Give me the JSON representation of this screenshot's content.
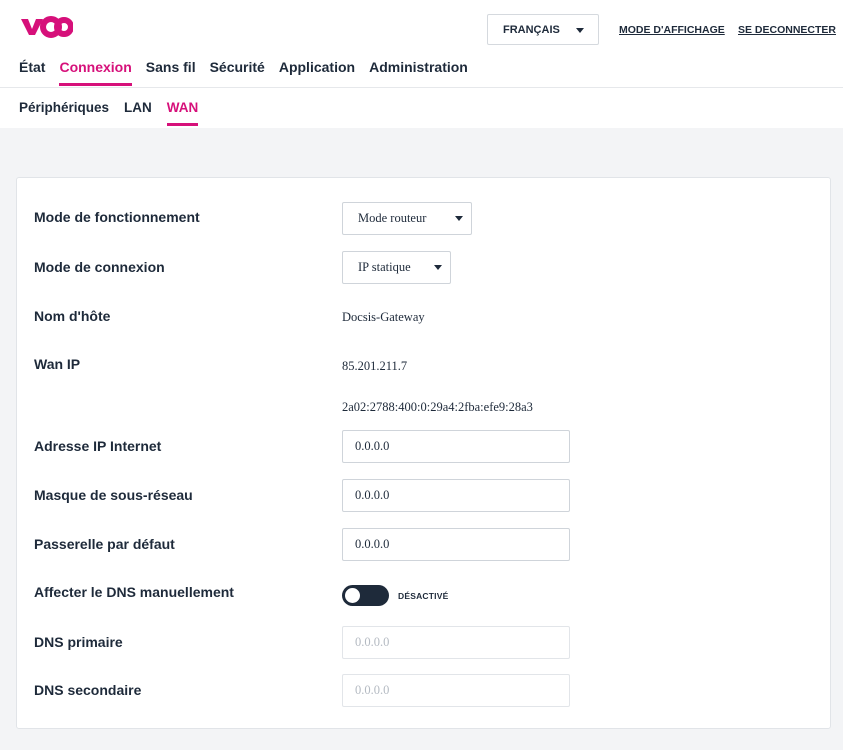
{
  "brand": {
    "logo_text": "voo",
    "accent": "#d6107a"
  },
  "header": {
    "language": "FRANÇAIS",
    "display_mode": "MODE D'AFFICHAGE",
    "logout": "SE DECONNECTER"
  },
  "main_nav": [
    "État",
    "Connexion",
    "Sans fil",
    "Sécurité",
    "Application",
    "Administration"
  ],
  "main_nav_active": "Connexion",
  "sub_nav": [
    "Périphériques",
    "LAN",
    "WAN"
  ],
  "sub_nav_active": "WAN",
  "form": {
    "operating_mode": {
      "label": "Mode de fonctionnement",
      "value": "Mode routeur"
    },
    "connection_mode": {
      "label": "Mode de connexion",
      "value": "IP statique"
    },
    "hostname": {
      "label": "Nom d'hôte",
      "value": "Docsis-Gateway"
    },
    "wan_ip": {
      "label": "Wan IP",
      "ipv4": "85.201.211.7",
      "ipv6": "2a02:2788:400:0:29a4:2fba:efe9:28a3"
    },
    "internet_ip": {
      "label": "Adresse IP Internet",
      "value": "0.0.0.0"
    },
    "subnet_mask": {
      "label": "Masque de sous-réseau",
      "value": "0.0.0.0"
    },
    "gateway": {
      "label": "Passerelle par défaut",
      "value": "0.0.0.0"
    },
    "manual_dns": {
      "label": "Affecter le DNS manuellement",
      "state": "DÉSACTIVÉ",
      "enabled": false
    },
    "dns_primary": {
      "label": "DNS primaire",
      "placeholder": "0.0.0.0"
    },
    "dns_secondary": {
      "label": "DNS secondaire",
      "placeholder": "0.0.0.0"
    }
  }
}
